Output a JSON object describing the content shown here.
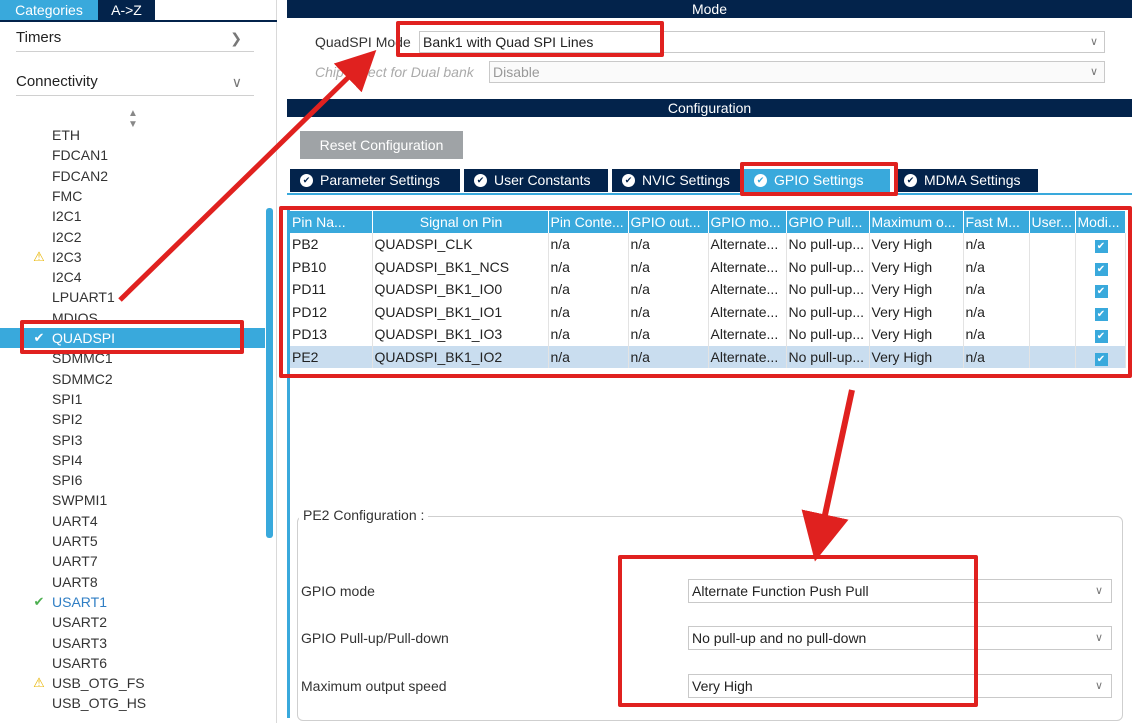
{
  "sidebar": {
    "tabs": [
      "Categories",
      "A->Z"
    ],
    "groups": [
      {
        "label": "Timers",
        "chevron": ">"
      },
      {
        "label": "Connectivity",
        "chevron": "v"
      }
    ],
    "peripherals": [
      {
        "label": "ETH",
        "status": "none"
      },
      {
        "label": "FDCAN1",
        "status": "none"
      },
      {
        "label": "FDCAN2",
        "status": "none"
      },
      {
        "label": "FMC",
        "status": "none"
      },
      {
        "label": "I2C1",
        "status": "none"
      },
      {
        "label": "I2C2",
        "status": "none"
      },
      {
        "label": "I2C3",
        "status": "warning"
      },
      {
        "label": "I2C4",
        "status": "none"
      },
      {
        "label": "LPUART1",
        "status": "none"
      },
      {
        "label": "MDIOS",
        "status": "none"
      },
      {
        "label": "QUADSPI",
        "status": "selected"
      },
      {
        "label": "SDMMC1",
        "status": "none"
      },
      {
        "label": "SDMMC2",
        "status": "none"
      },
      {
        "label": "SPI1",
        "status": "none"
      },
      {
        "label": "SPI2",
        "status": "none"
      },
      {
        "label": "SPI3",
        "status": "none"
      },
      {
        "label": "SPI4",
        "status": "none"
      },
      {
        "label": "SPI6",
        "status": "none"
      },
      {
        "label": "SWPMI1",
        "status": "none"
      },
      {
        "label": "UART4",
        "status": "none"
      },
      {
        "label": "UART5",
        "status": "none"
      },
      {
        "label": "UART7",
        "status": "none"
      },
      {
        "label": "UART8",
        "status": "none"
      },
      {
        "label": "USART1",
        "status": "ok"
      },
      {
        "label": "USART2",
        "status": "none"
      },
      {
        "label": "USART3",
        "status": "none"
      },
      {
        "label": "USART6",
        "status": "none"
      },
      {
        "label": "USB_OTG_FS",
        "status": "warning"
      },
      {
        "label": "USB_OTG_HS",
        "status": "none"
      }
    ]
  },
  "mode": {
    "header": "Mode",
    "quadspi_mode_label": "QuadSPI Mode",
    "quadspi_mode_value": "Bank1 with Quad SPI Lines",
    "chip_select_label": "Chip Select for Dual bank",
    "chip_select_value": "Disable"
  },
  "configuration": {
    "header": "Configuration",
    "reset_button": "Reset Configuration",
    "tabs": [
      "Parameter Settings",
      "User Constants",
      "NVIC Settings",
      "GPIO Settings",
      "MDMA Settings"
    ],
    "active_tab": "GPIO Settings"
  },
  "gpio_table": {
    "columns": [
      "Pin Na...",
      "Signal on Pin",
      "Pin Conte...",
      "GPIO out...",
      "GPIO mo...",
      "GPIO Pull...",
      "Maximum o...",
      "Fast M...",
      "User...",
      "Modi..."
    ],
    "rows": [
      [
        "PB2",
        "QUADSPI_CLK",
        "n/a",
        "n/a",
        "Alternate...",
        "No pull-up...",
        "Very High",
        "n/a",
        "",
        true
      ],
      [
        "PB10",
        "QUADSPI_BK1_NCS",
        "n/a",
        "n/a",
        "Alternate...",
        "No pull-up...",
        "Very High",
        "n/a",
        "",
        true
      ],
      [
        "PD11",
        "QUADSPI_BK1_IO0",
        "n/a",
        "n/a",
        "Alternate...",
        "No pull-up...",
        "Very High",
        "n/a",
        "",
        true
      ],
      [
        "PD12",
        "QUADSPI_BK1_IO1",
        "n/a",
        "n/a",
        "Alternate...",
        "No pull-up...",
        "Very High",
        "n/a",
        "",
        true
      ],
      [
        "PD13",
        "QUADSPI_BK1_IO3",
        "n/a",
        "n/a",
        "Alternate...",
        "No pull-up...",
        "Very High",
        "n/a",
        "",
        true
      ],
      [
        "PE2",
        "QUADSPI_BK1_IO2",
        "n/a",
        "n/a",
        "Alternate...",
        "No pull-up...",
        "Very High",
        "n/a",
        "",
        true
      ]
    ],
    "selected_row": "PE2"
  },
  "pe2_config": {
    "title": "PE2 Configuration :",
    "fields": [
      {
        "label": "GPIO mode",
        "value": "Alternate Function Push Pull"
      },
      {
        "label": "GPIO Pull-up/Pull-down",
        "value": "No pull-up and no pull-down"
      },
      {
        "label": "Maximum output speed",
        "value": "Very High"
      }
    ]
  },
  "colors": {
    "accent": "#39a9dc",
    "header_dark": "#03234b",
    "annotation_red": "#e0211f",
    "warning": "#e8b400",
    "ok": "#4caf50"
  }
}
